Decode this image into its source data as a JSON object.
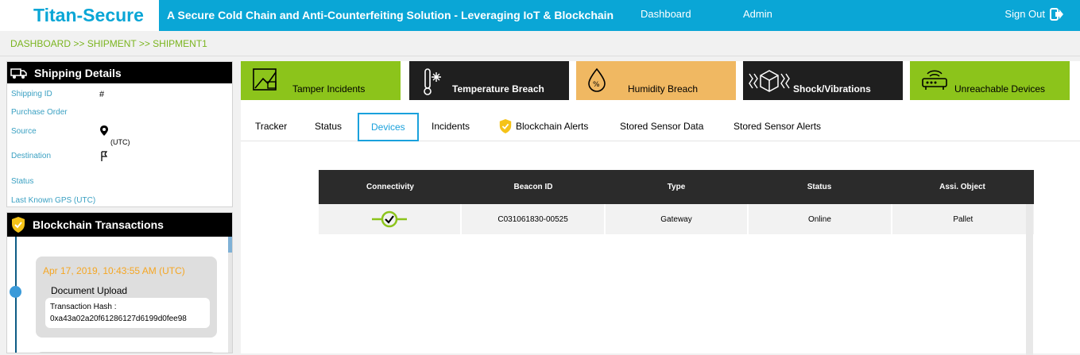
{
  "header": {
    "brand": "Titan-Secure",
    "subtitle": "A Secure Cold Chain and Anti-Counterfeiting Solution - Leveraging IoT & Blockchain",
    "nav": [
      "Dashboard",
      "Admin"
    ],
    "signout": "Sign Out"
  },
  "breadcrumb": "DASHBOARD >> SHIPMENT >> SHIPMENT1",
  "shipping": {
    "title": "Shipping Details",
    "labels": {
      "shipping_id": "Shipping ID",
      "purchase_order": "Purchase Order",
      "source": "Source",
      "destination": "Destination",
      "status": "Status",
      "gps": "Last Known GPS (UTC)"
    },
    "values": {
      "shipping_id": "#",
      "source_utc": "(UTC)"
    }
  },
  "blockchain": {
    "title": "Blockchain Transactions",
    "transaction": {
      "date": "Apr 17, 2019, 10:43:55 AM (UTC)",
      "type": "Document Upload",
      "hash_label": "Transaction Hash :",
      "hash_value": "0xa43a02a20f61286127d6199d0fee98"
    }
  },
  "tiles": [
    {
      "label": "Tamper Incidents",
      "bg": "#8cc41b",
      "fg": "#000000"
    },
    {
      "label": "Temperature Breach",
      "bg": "#1f1f1f",
      "fg": "#ffffff"
    },
    {
      "label": "Humidity Breach",
      "bg": "#f0b862",
      "fg": "#000000"
    },
    {
      "label": "Shock/Vibrations",
      "bg": "#1f1f1f",
      "fg": "#ffffff"
    },
    {
      "label": "Unreachable Devices",
      "bg": "#8cc41b",
      "fg": "#000000"
    }
  ],
  "tabs": [
    "Tracker",
    "Status",
    "Devices",
    "Incidents",
    "Blockchain Alerts",
    "Stored Sensor Data",
    "Stored Sensor Alerts"
  ],
  "table": {
    "columns": [
      "Connectivity",
      "Beacon ID",
      "Type",
      "Status",
      "Assi. Object"
    ],
    "rows": [
      {
        "beacon_id": "C031061830-00525",
        "type": "Gateway",
        "status": "Online",
        "object": "Pallet"
      }
    ]
  },
  "colors": {
    "accent": "#0aa6d6",
    "green": "#8cc41b",
    "orange": "#f5a623"
  }
}
